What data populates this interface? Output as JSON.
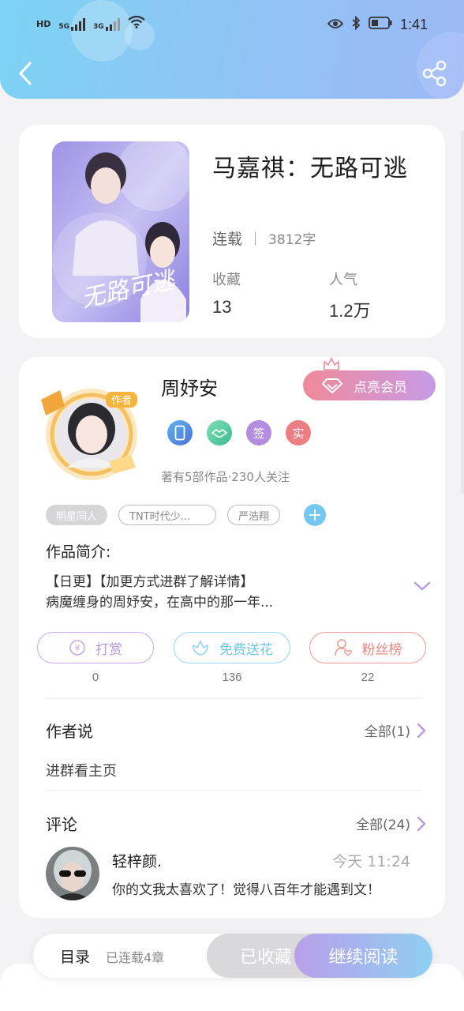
{
  "status_bar": {
    "left_tags": [
      "HD",
      "5G",
      "3G"
    ],
    "time": "1:41"
  },
  "book": {
    "title": "马嘉祺：无路可逃",
    "status": "连载",
    "words": "3812字",
    "favorites_label": "收藏",
    "favorites_value": "13",
    "popularity_label": "人气",
    "popularity_value": "1.2万",
    "cover_text": "无路可逃"
  },
  "author": {
    "name": "周妤安",
    "avatar_badge": "作者",
    "vip_label": "点亮会员",
    "badges": [
      "签",
      "实"
    ],
    "info": "著有5部作品·230人关注"
  },
  "tags": [
    "明星同人",
    "TNT时代少...",
    "严浩翔"
  ],
  "intro": {
    "label": "作品简介:",
    "line1": "【日更】【加更方式进群了解详情】",
    "line2": "病魔缠身的周妤安，在高中的那一年..."
  },
  "actions": {
    "tip_label": "打赏",
    "tip_count": "0",
    "flower_label": "免费送花",
    "flower_count": "136",
    "fans_label": "粉丝榜",
    "fans_count": "22"
  },
  "author_says": {
    "title": "作者说",
    "more": "全部(1)",
    "text": "进群看主页"
  },
  "comments": {
    "title": "评论",
    "more": "全部(24)",
    "user": "轻梓颜.",
    "time": "今天 11:24",
    "text": "你的文我太喜欢了！觉得八百年才能遇到文！"
  },
  "bottom": {
    "toc": "目录",
    "toc_sub": "已连载4章",
    "fav_button": "已收藏",
    "read_button": "继续阅读"
  },
  "colors": {
    "header_gradient_start": "#7dd3f3",
    "header_gradient_end": "#9db8f6",
    "vip_gradient_start": "#f08a9a",
    "vip_gradient_end": "#c79ae6",
    "tip_color": "#b596dd",
    "flower_color": "#6cc7e3",
    "fans_color": "#e8857f"
  }
}
